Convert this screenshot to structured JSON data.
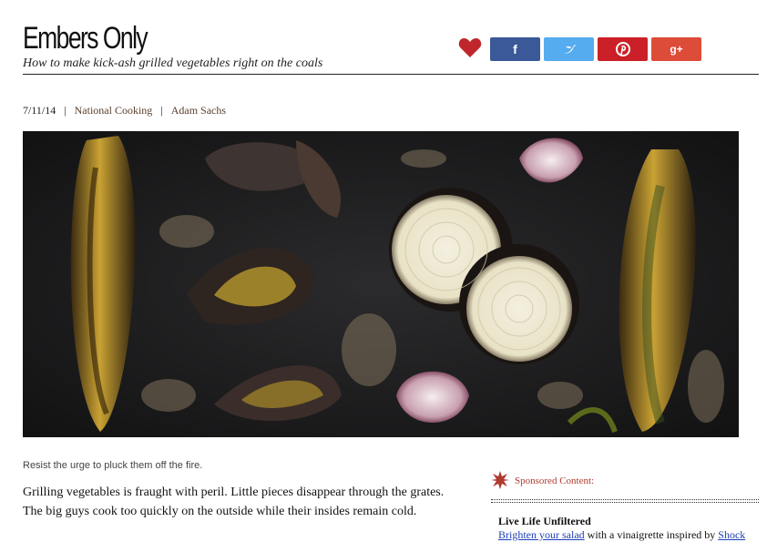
{
  "article": {
    "title": "Embers Only",
    "subtitle": "How to make kick-ash grilled vegetables right on the coals",
    "date": "7/11/14",
    "separator": "|",
    "section": "National Cooking",
    "author": "Adam Sachs",
    "caption": "Resist the urge to pluck them off the fire.",
    "body": "Grilling vegetables is fraught with peril. Little pieces disappear through the grates. The big guys cook too quickly on the outside while their insides remain cold."
  },
  "share": {
    "buttons": [
      {
        "label": "f",
        "icon": "facebook-icon",
        "color": "#3b5998"
      },
      {
        "label": "▼",
        "icon": "twitter-icon",
        "color": "#55acee"
      },
      {
        "label": "P",
        "icon": "pinterest-icon",
        "color": "#cb2027"
      },
      {
        "label": "g+",
        "icon": "google-plus-icon",
        "color": "#dd4b39"
      }
    ],
    "heart_color": "#c0272d"
  },
  "sponsored": {
    "label": "Sponsored Content:",
    "promo_title": "Live Life Unfiltered",
    "link_text": "Brighten your salad",
    "middle_text": " with a vinaigrette inspired by ",
    "brand_link": "Shock"
  },
  "colors": {
    "accent": "#b03a2e",
    "link": "#1a3fb5",
    "meta_link": "#5a3e2b"
  }
}
